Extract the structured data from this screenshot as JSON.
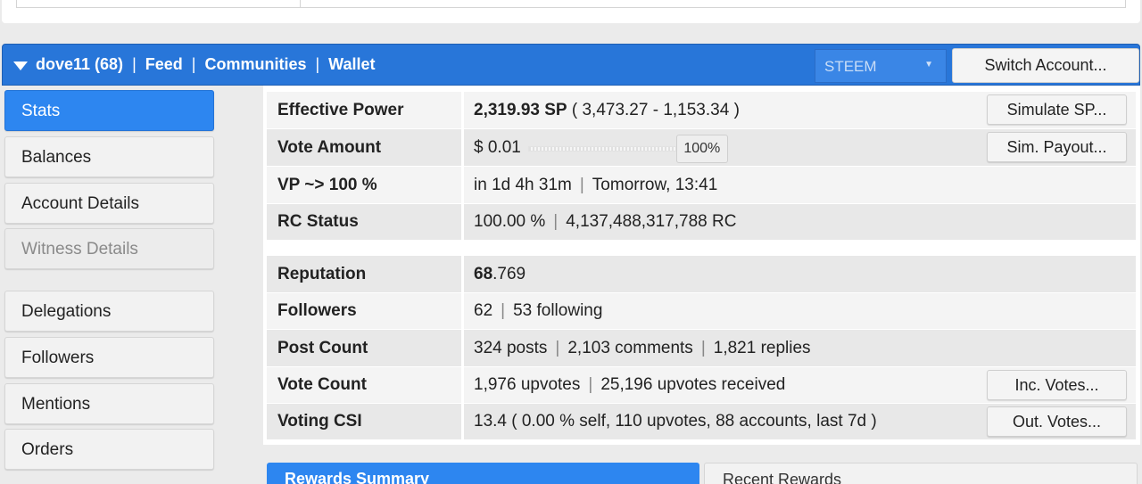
{
  "header": {
    "account": "dove11 (68)",
    "sep": "|",
    "links": [
      "Feed",
      "Communities",
      "Wallet"
    ],
    "select_value": "STEEM",
    "switch_label": "Switch Account..."
  },
  "sidebar": {
    "items": [
      {
        "label": "Stats"
      },
      {
        "label": "Balances"
      },
      {
        "label": "Account Details"
      },
      {
        "label": "Witness Details"
      },
      {
        "label": "Delegations"
      },
      {
        "label": "Followers"
      },
      {
        "label": "Mentions"
      },
      {
        "label": "Orders"
      }
    ]
  },
  "stats": {
    "effective_power": {
      "label": "Effective Power",
      "value_bold": "2,319.93 SP",
      "value_rest": "( 3,473.27 - 1,153.34 )",
      "button": "Simulate SP..."
    },
    "vote_amount": {
      "label": "Vote Amount",
      "value": "$ 0.01",
      "slider_pct": "100%",
      "button": "Sim. Payout..."
    },
    "vp": {
      "label": "VP ~> 100 %",
      "eta": "in 1d 4h 31m",
      "time": "Tomorrow, 13:41"
    },
    "rc": {
      "label": "RC Status",
      "pct": "100.00 %",
      "rc": "4,137,488,317,788 RC"
    },
    "reputation": {
      "label": "Reputation",
      "int": "68",
      "dec": ".769"
    },
    "followers": {
      "label": "Followers",
      "followers": "62",
      "following": "53 following"
    },
    "post_count": {
      "label": "Post Count",
      "posts": "324 posts",
      "comments": "2,103 comments",
      "replies": "1,821 replies"
    },
    "vote_count": {
      "label": "Vote Count",
      "upvotes": "1,976 upvotes",
      "received": "25,196 upvotes received",
      "button": "Inc. Votes..."
    },
    "voting_csi": {
      "label": "Voting CSI",
      "value": "13.4 ( 0.00 % self, 110 upvotes, 88 accounts, last 7d )",
      "button": "Out. Votes..."
    }
  },
  "tabs": {
    "rewards_summary": "Rewards Summary",
    "recent_rewards": "Recent Rewards"
  }
}
